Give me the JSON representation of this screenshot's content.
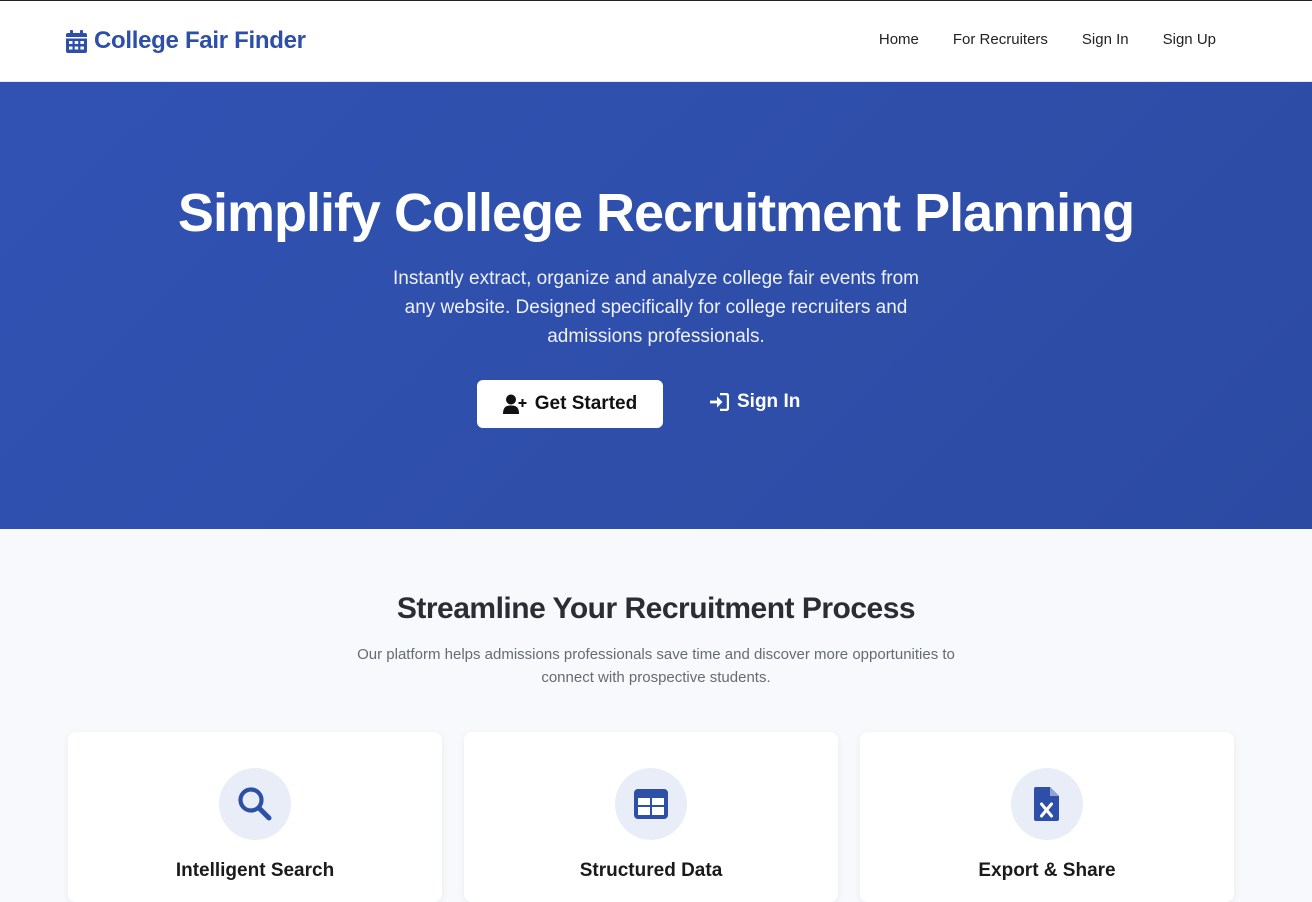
{
  "brand": {
    "name": "College Fair Finder",
    "icon": "calendar-icon"
  },
  "nav": {
    "links": [
      {
        "label": "Home"
      },
      {
        "label": "For Recruiters"
      },
      {
        "label": "Sign In"
      },
      {
        "label": "Sign Up"
      }
    ]
  },
  "hero": {
    "title": "Simplify College Recruitment Planning",
    "subtitle": "Instantly extract, organize and analyze college fair events from any website. Designed specifically for college recruiters and admissions professionals.",
    "primary_button": {
      "label": "Get Started",
      "icon": "user-plus-icon"
    },
    "secondary_button": {
      "label": "Sign In",
      "icon": "sign-in-icon"
    },
    "background_color": "#2e4ea9"
  },
  "features": {
    "title": "Streamline Your Recruitment Process",
    "subtitle": "Our platform helps admissions professionals save time and discover more opportunities to connect with prospective students.",
    "cards": [
      {
        "title": "Intelligent Search",
        "icon": "search-icon"
      },
      {
        "title": "Structured Data",
        "icon": "table-icon"
      },
      {
        "title": "Export & Share",
        "icon": "excel-file-icon"
      }
    ]
  },
  "colors": {
    "accent": "#2e4fa8",
    "icon_bg": "#e9edf8"
  }
}
